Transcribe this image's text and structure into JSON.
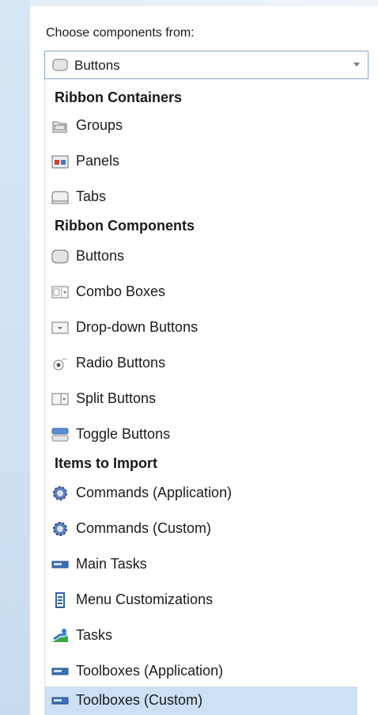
{
  "label": "Choose components from:",
  "combo": {
    "selected": "Buttons",
    "icon": "button-icon"
  },
  "headers": {
    "ribbon_containers": "Ribbon Containers",
    "ribbon_components": "Ribbon Components",
    "items_to_import": "Items to Import"
  },
  "items": [
    {
      "label": "Groups",
      "icon": "group-icon"
    },
    {
      "label": "Panels",
      "icon": "panel-icon"
    },
    {
      "label": "Tabs",
      "icon": "tab-icon"
    },
    {
      "label": "Buttons",
      "icon": "button-icon"
    },
    {
      "label": "Combo Boxes",
      "icon": "combo-box-icon"
    },
    {
      "label": "Drop-down Buttons",
      "icon": "dropdown-button-icon"
    },
    {
      "label": "Radio Buttons",
      "icon": "radio-button-icon"
    },
    {
      "label": "Split Buttons",
      "icon": "split-button-icon"
    },
    {
      "label": "Toggle Buttons",
      "icon": "toggle-button-icon"
    },
    {
      "label": "Commands (Application)",
      "icon": "gear-icon"
    },
    {
      "label": "Commands (Custom)",
      "icon": "gear-icon"
    },
    {
      "label": "Main Tasks",
      "icon": "task-bar-icon"
    },
    {
      "label": "Menu Customizations",
      "icon": "menu-icon"
    },
    {
      "label": "Tasks",
      "icon": "tasks-icon"
    },
    {
      "label": "Toolboxes (Application)",
      "icon": "toolbox-icon"
    },
    {
      "label": "Toolboxes (Custom)",
      "icon": "toolbox-icon",
      "selected": true
    }
  ],
  "colors": {
    "selection": "#cde0f4",
    "border": "#8aa7c9",
    "sidebar": "#d7e6f5"
  }
}
